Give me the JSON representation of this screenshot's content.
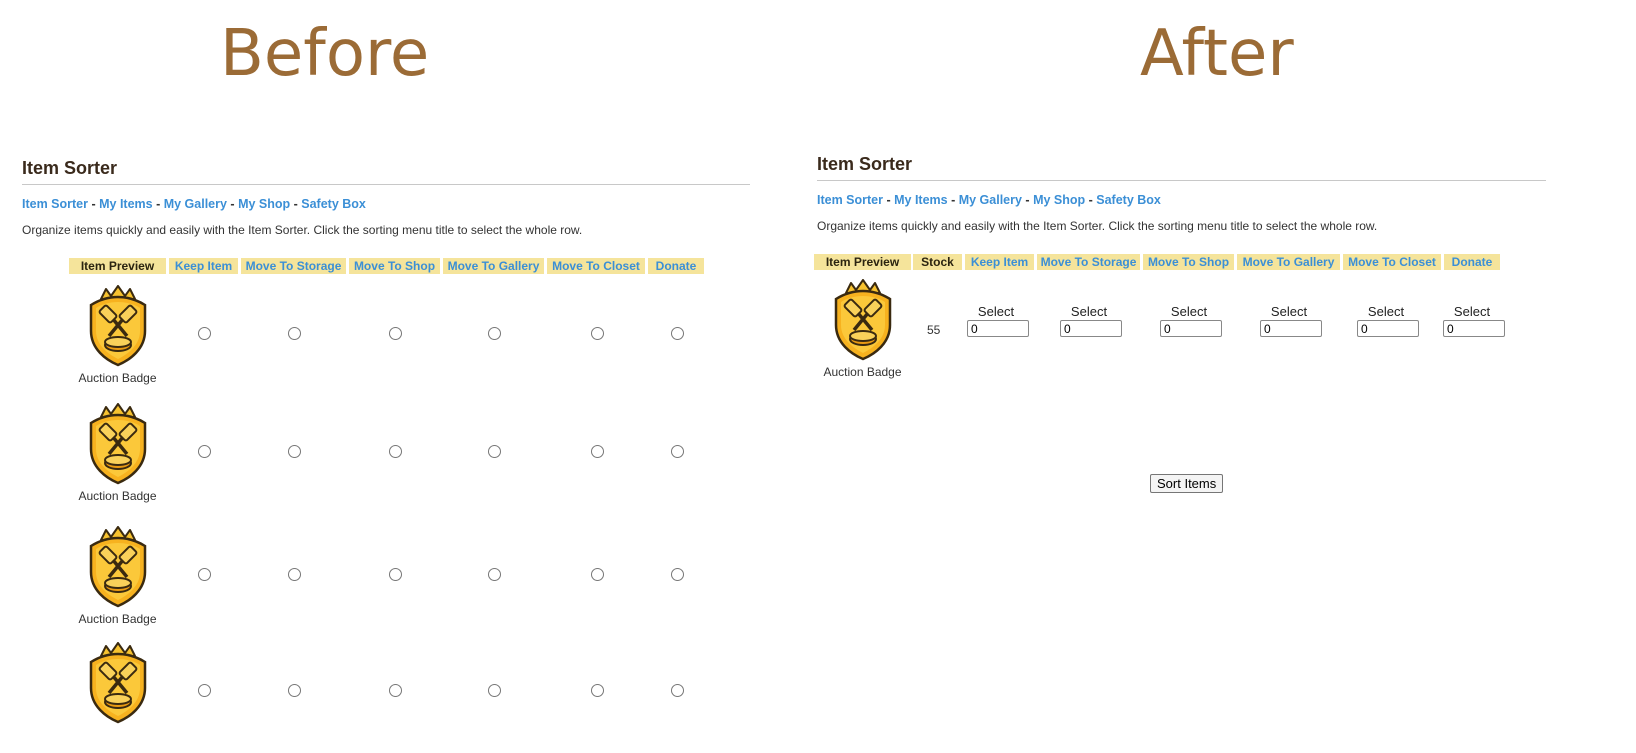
{
  "labels": {
    "before": "Before",
    "after": "After"
  },
  "before": {
    "title": "Item Sorter",
    "nav": [
      "Item Sorter",
      "My Items",
      "My Gallery",
      "My Shop",
      "Safety Box"
    ],
    "description": "Organize items quickly and easily with the Item Sorter. Click the sorting menu title to select the whole row.",
    "columns": [
      "Item Preview",
      "Keep Item",
      "Move To Storage",
      "Move To Shop",
      "Move To Gallery",
      "Move To Closet",
      "Donate"
    ],
    "items": [
      {
        "name": "Auction Badge"
      },
      {
        "name": "Auction Badge"
      },
      {
        "name": "Auction Badge"
      },
      {
        "name": ""
      }
    ]
  },
  "after": {
    "title": "Item Sorter",
    "nav": [
      "Item Sorter",
      "My Items",
      "My Gallery",
      "My Shop",
      "Safety Box"
    ],
    "description": "Organize items quickly and easily with the Item Sorter. Click the sorting menu title to select the whole row.",
    "columns": [
      "Item Preview",
      "Stock",
      "Keep Item",
      "Move To Storage",
      "Move To Shop",
      "Move To Gallery",
      "Move To Closet",
      "Donate"
    ],
    "select_label": "Select",
    "item": {
      "name": "Auction Badge",
      "stock": "55",
      "values": [
        "0",
        "0",
        "0",
        "0",
        "0",
        "0"
      ]
    },
    "sort_button": "Sort Items"
  },
  "colors": {
    "header_bg": "#f5e49b",
    "link": "#3b8fd6",
    "title_brown": "#9b6b36",
    "badge_gold": "#f7b21f"
  }
}
